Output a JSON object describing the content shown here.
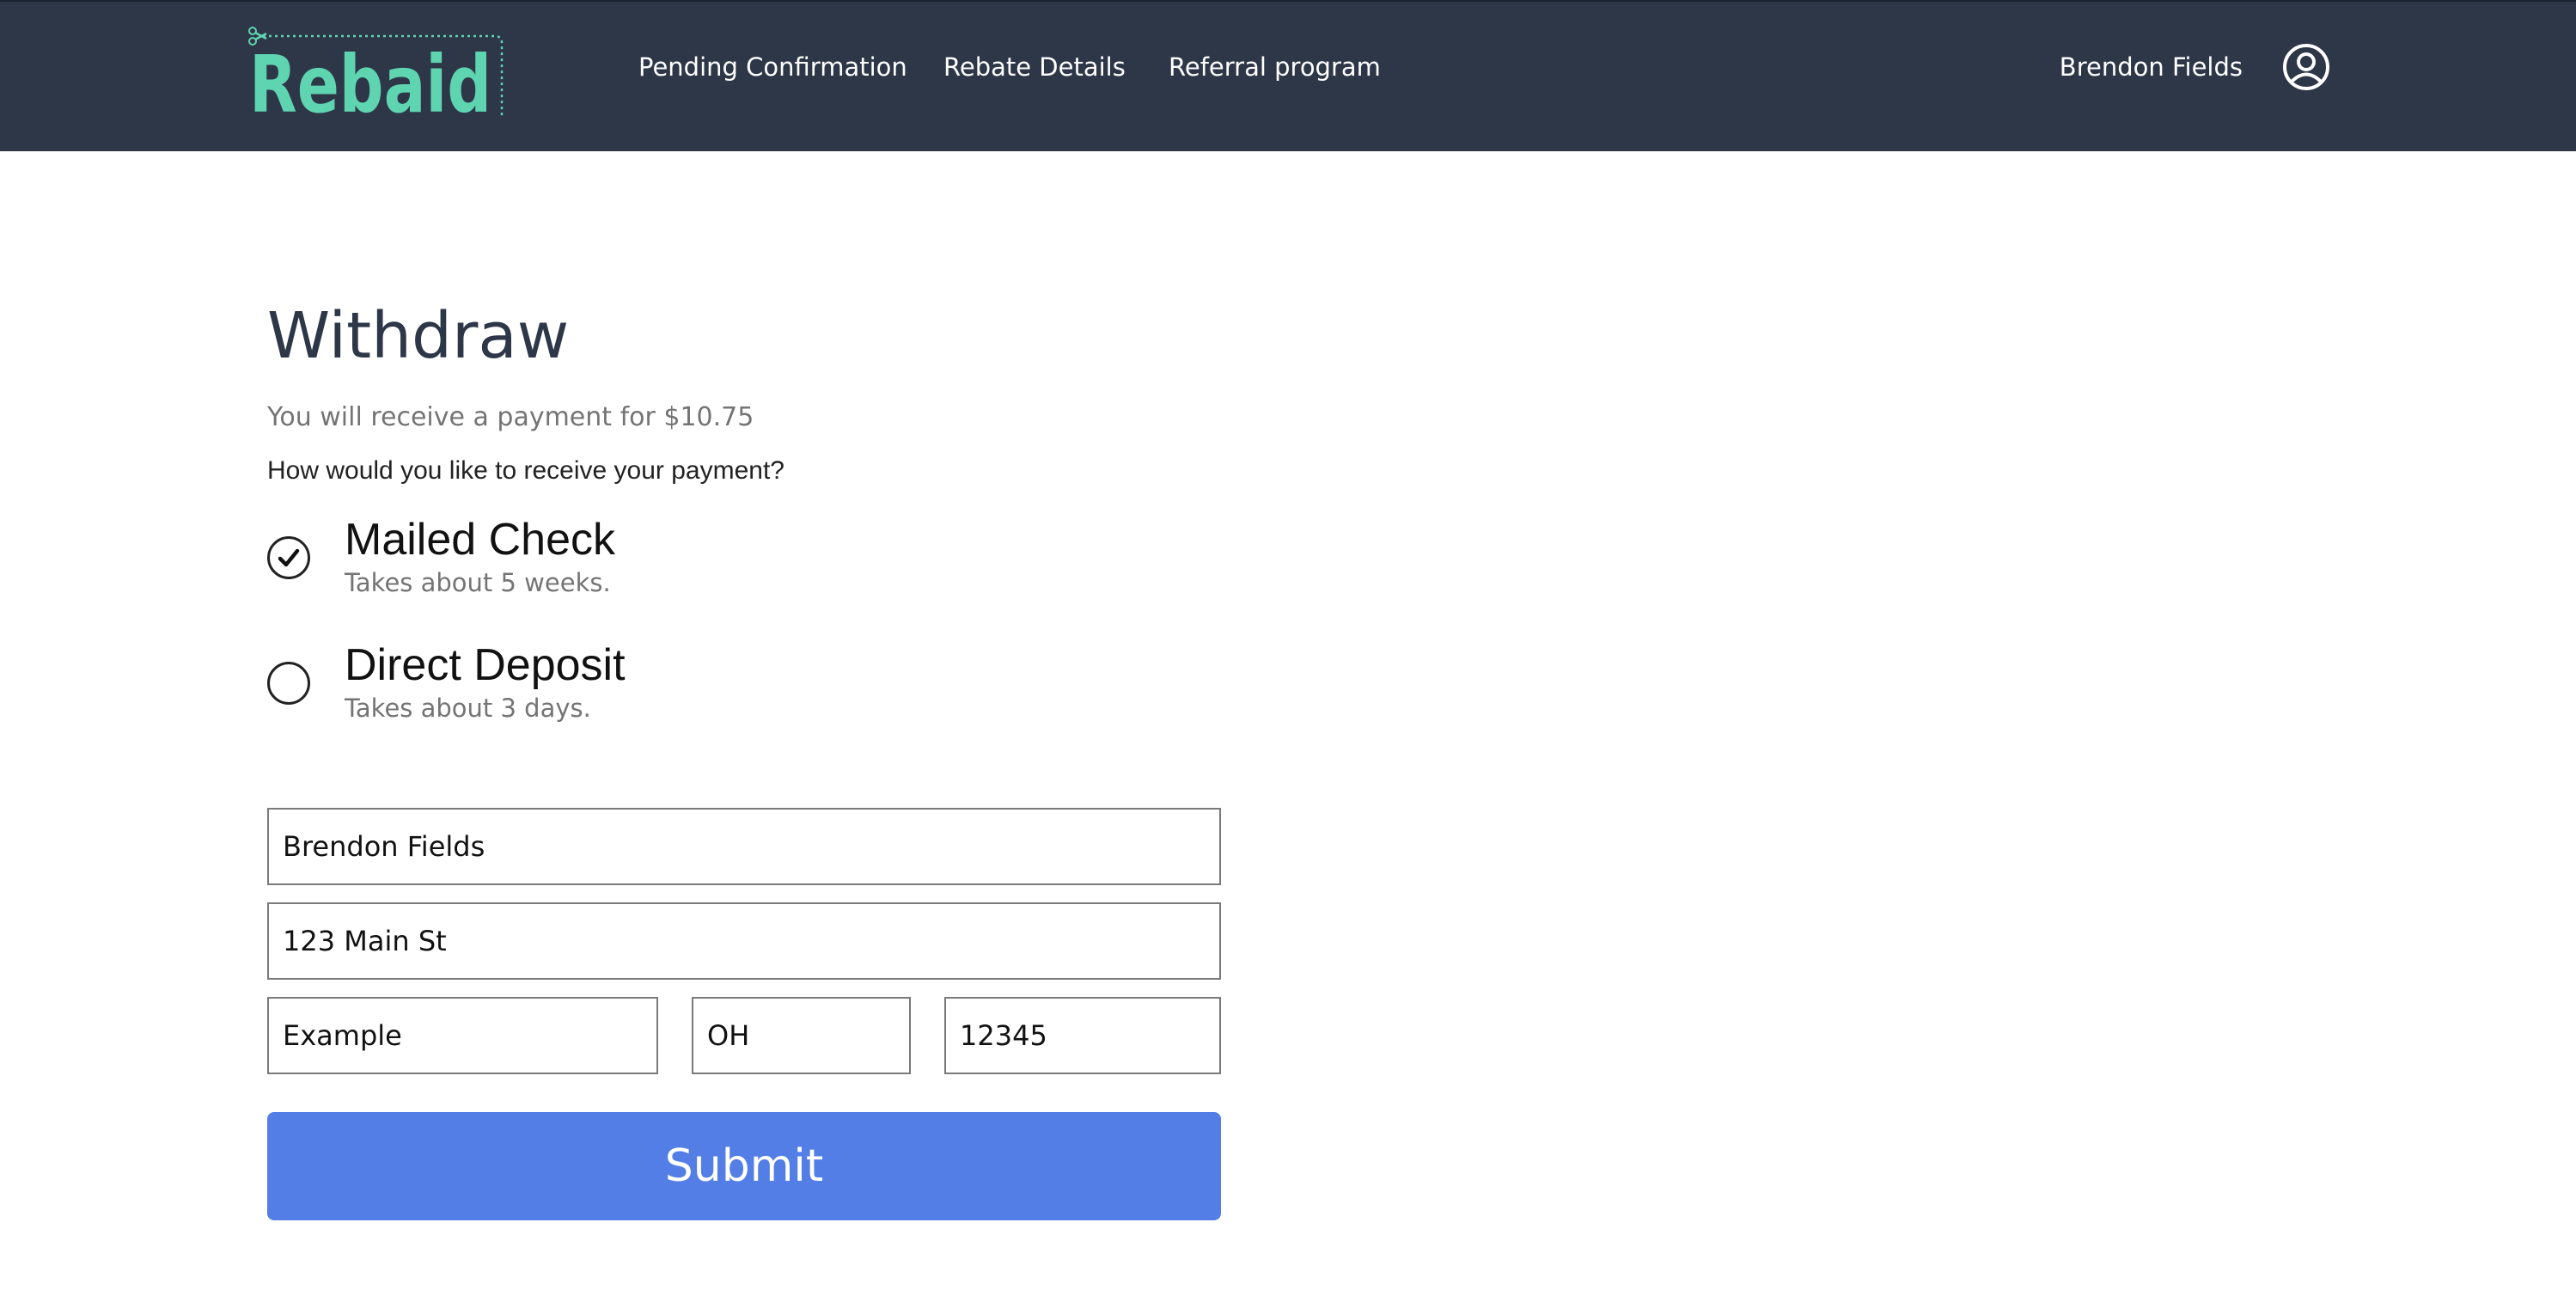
{
  "brand": {
    "logo_text": "Rebaid",
    "logo_color": "#5fd4b0"
  },
  "header": {
    "background": "#2d3748",
    "nav": [
      {
        "label": "Pending Confirmation"
      },
      {
        "label": "Rebate Details"
      },
      {
        "label": "Referral program"
      }
    ],
    "user_name": "Brendon Fields",
    "avatar_icon": "user-circle-icon"
  },
  "withdraw": {
    "title": "Withdraw",
    "payment_note": "You will receive a payment for $10.75",
    "question": "How would you like to receive your payment?",
    "options": [
      {
        "label": "Mailed Check",
        "description": "Takes about 5 weeks.",
        "selected": true
      },
      {
        "label": "Direct Deposit",
        "description": "Takes about 3 days.",
        "selected": false
      }
    ],
    "form": {
      "name": "Brendon Fields",
      "street": "123 Main St",
      "city": "Example",
      "state": "OH",
      "zip": "12345"
    },
    "submit_label": "Submit",
    "submit_color": "#537ee5"
  }
}
